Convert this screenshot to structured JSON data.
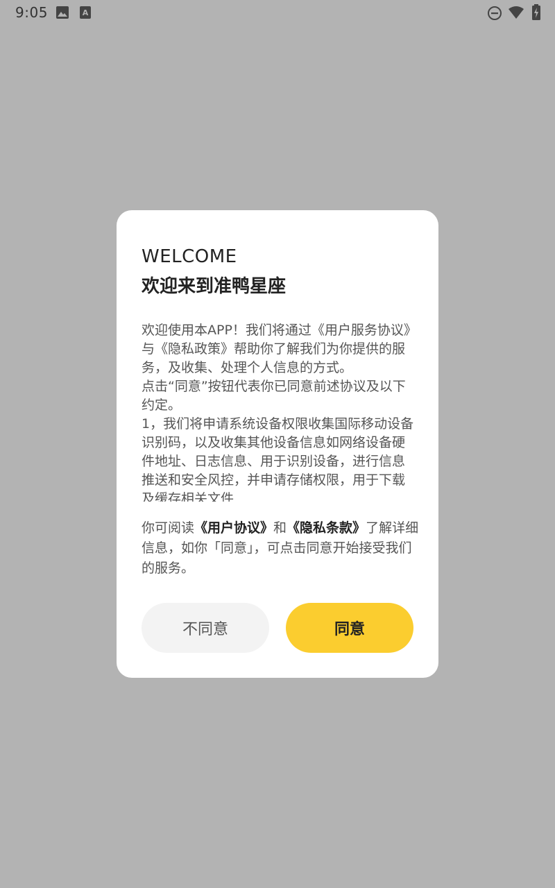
{
  "status_bar": {
    "time": "9:05",
    "left_icons": [
      "image-icon",
      "text-a-icon"
    ],
    "right_icons": [
      "do-not-disturb-icon",
      "wifi-icon",
      "battery-charging-icon"
    ]
  },
  "dialog": {
    "title": "WELCOME",
    "subtitle": "欢迎来到准鸭星座",
    "agreement_text": "欢迎使用本APP！我们将通过《用户服务协议》与《隐私政策》帮助你了解我们为你提供的服务，及收集、处理个人信息的方式。\n点击“同意”按钮代表你已同意前述协议及以下约定。\n1，我们将申请系统设备权限收集国际移动设备识别码，以及收集其他设备信息如网络设备硬件地址、日志信息、用于识别设备，进行信息推送和安全风控，并申请存储权限，用于下载及缓存相关文件",
    "notice": {
      "prefix": "你可阅读",
      "user_agreement_link": "《用户协议》",
      "conjunction": "和",
      "privacy_link": "《隐私条款》",
      "suffix": "了解详细信息，如你「同意」，可点击同意开始接受我们的服务。"
    },
    "buttons": {
      "disagree": "不同意",
      "agree": "同意"
    }
  },
  "colors": {
    "overlay": "#b3b3b3",
    "dialog_bg": "#ffffff",
    "agree_button": "#fbcd2f",
    "disagree_button": "#f3f3f3"
  }
}
